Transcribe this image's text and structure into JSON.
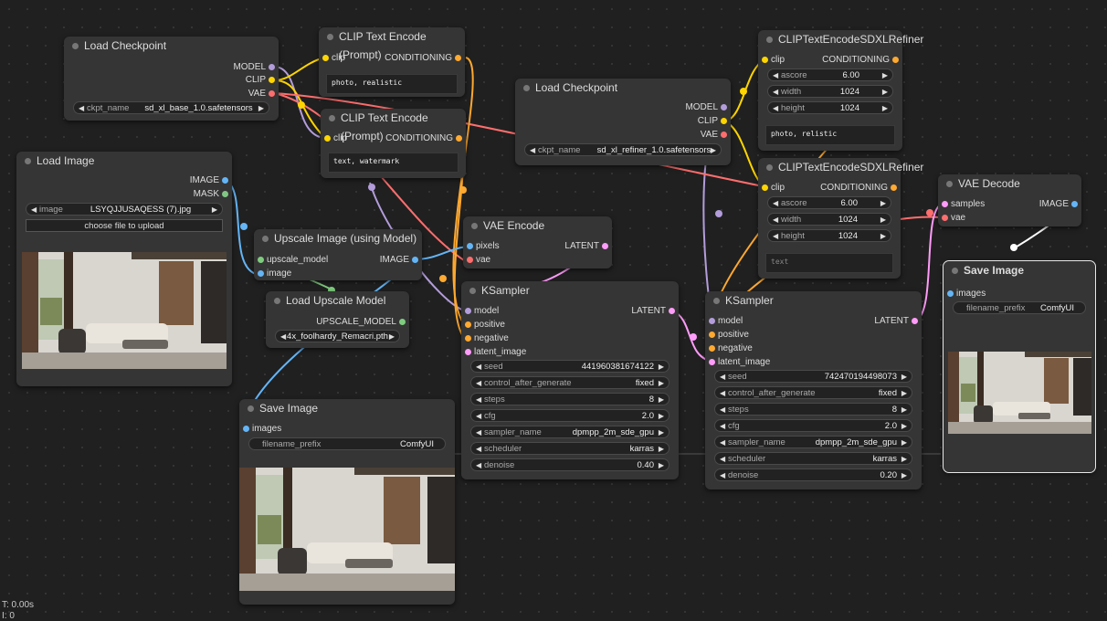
{
  "status": {
    "time": "T: 0.00s",
    "second_line": "I: 0"
  },
  "colors": {
    "model": "#b39ddb",
    "clip": "#ffd500",
    "vae": "#ff6e6e",
    "image": "#64b5f6",
    "latent": "#ff9cf9",
    "conditioning": "#ffa931",
    "mask": "#81c784",
    "upscale": "#7fcc7f"
  },
  "load_ckpt_base": {
    "title": "Load Checkpoint",
    "out_model": "MODEL",
    "out_clip": "CLIP",
    "out_vae": "VAE",
    "w_label": "ckpt_name",
    "w_value": "sd_xl_base_1.0.safetensors"
  },
  "clip_pos": {
    "title": "CLIP Text Encode (Prompt)",
    "in_clip": "clip",
    "out": "CONDITIONING",
    "text": "photo, realistic"
  },
  "clip_neg": {
    "title": "CLIP Text Encode (Prompt)",
    "in_clip": "clip",
    "out": "CONDITIONING",
    "text": "text, watermark"
  },
  "load_ckpt_ref": {
    "title": "Load Checkpoint",
    "out_model": "MODEL",
    "out_clip": "CLIP",
    "out_vae": "VAE",
    "w_label": "ckpt_name",
    "w_value": "sd_xl_refiner_1.0.safetensors"
  },
  "refiner_pos": {
    "title": "CLIPTextEncodeSDXLRefiner",
    "in_clip": "clip",
    "out": "CONDITIONING",
    "ascore_l": "ascore",
    "ascore_v": "6.00",
    "width_l": "width",
    "width_v": "1024",
    "height_l": "height",
    "height_v": "1024",
    "text": "photo, relistic"
  },
  "refiner_neg": {
    "title": "CLIPTextEncodeSDXLRefiner",
    "in_clip": "clip",
    "out": "CONDITIONING",
    "ascore_l": "ascore",
    "ascore_v": "6.00",
    "width_l": "width",
    "width_v": "1024",
    "height_l": "height",
    "height_v": "1024",
    "placeholder": "text"
  },
  "load_image": {
    "title": "Load Image",
    "out_image": "IMAGE",
    "out_mask": "MASK",
    "w_label": "image",
    "w_value": "LSYQJJUSAQESS (7).jpg",
    "upload": "choose file to upload"
  },
  "upscale_image": {
    "title": "Upscale Image (using Model)",
    "in_model": "upscale_model",
    "in_image": "image",
    "out": "IMAGE"
  },
  "load_upscale": {
    "title": "Load Upscale Model",
    "out": "UPSCALE_MODEL",
    "w_value": "4x_foolhardy_Remacri.pth"
  },
  "vae_encode": {
    "title": "VAE Encode",
    "in_pixels": "pixels",
    "in_vae": "vae",
    "out": "LATENT"
  },
  "ksampler1": {
    "title": "KSampler",
    "in_model": "model",
    "in_pos": "positive",
    "in_neg": "negative",
    "in_latent": "latent_image",
    "out": "LATENT",
    "widgets": [
      {
        "label": "seed",
        "value": "441960381674122"
      },
      {
        "label": "control_after_generate",
        "value": "fixed"
      },
      {
        "label": "steps",
        "value": "8"
      },
      {
        "label": "cfg",
        "value": "2.0"
      },
      {
        "label": "sampler_name",
        "value": "dpmpp_2m_sde_gpu"
      },
      {
        "label": "scheduler",
        "value": "karras"
      },
      {
        "label": "denoise",
        "value": "0.40"
      }
    ]
  },
  "ksampler2": {
    "title": "KSampler",
    "in_model": "model",
    "in_pos": "positive",
    "in_neg": "negative",
    "in_latent": "latent_image",
    "out": "LATENT",
    "widgets": [
      {
        "label": "seed",
        "value": "742470194498073"
      },
      {
        "label": "control_after_generate",
        "value": "fixed"
      },
      {
        "label": "steps",
        "value": "8"
      },
      {
        "label": "cfg",
        "value": "2.0"
      },
      {
        "label": "sampler_name",
        "value": "dpmpp_2m_sde_gpu"
      },
      {
        "label": "scheduler",
        "value": "karras"
      },
      {
        "label": "denoise",
        "value": "0.20"
      }
    ]
  },
  "vae_decode": {
    "title": "VAE Decode",
    "in_samples": "samples",
    "in_vae": "vae",
    "out": "IMAGE"
  },
  "save_image1": {
    "title": "Save Image",
    "in_images": "images",
    "w_label": "filename_prefix",
    "w_value": "ComfyUI"
  },
  "save_image2": {
    "title": "Save Image",
    "in_images": "images",
    "w_label": "filename_prefix",
    "w_value": "ComfyUI"
  }
}
